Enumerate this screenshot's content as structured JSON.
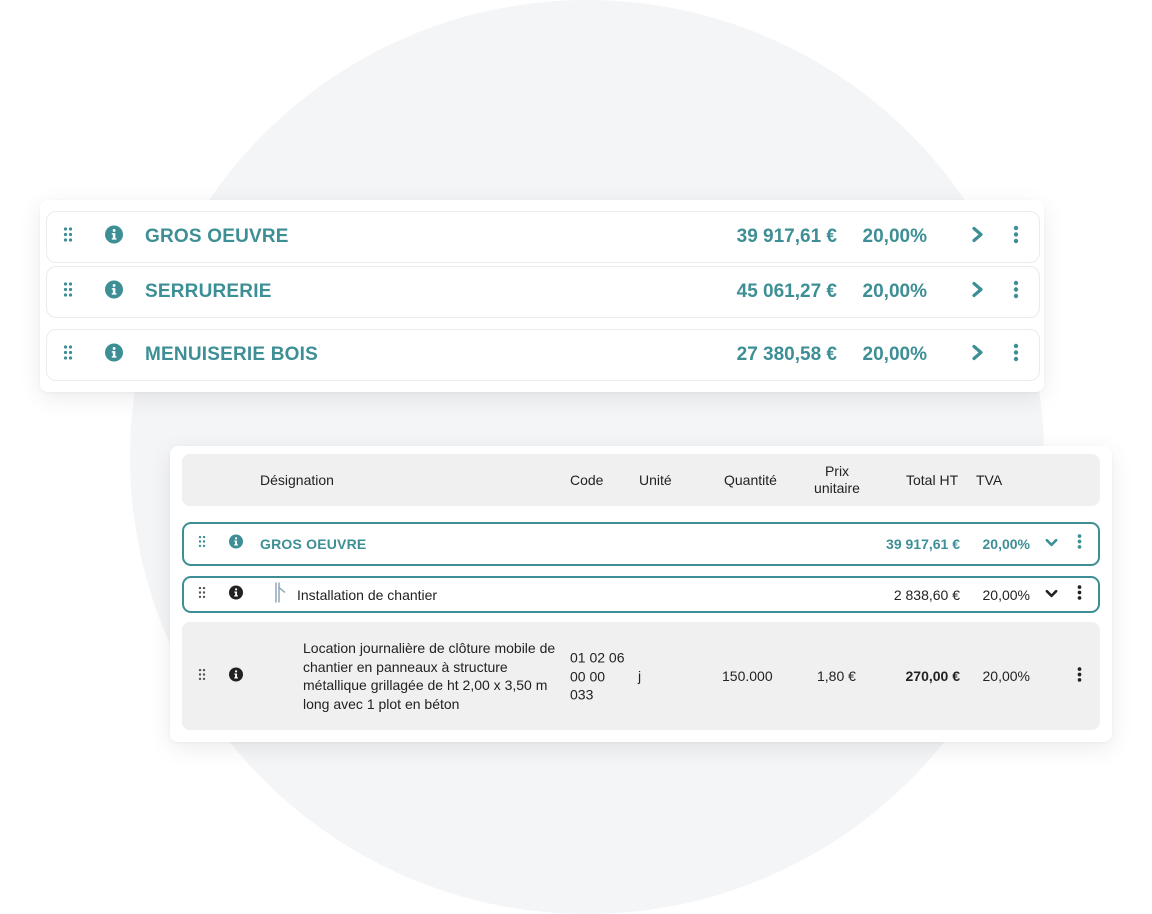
{
  "colors": {
    "accent": "#3d8f95",
    "row_border": "#e9ebee",
    "header_bg": "#f0f0f1",
    "background_circle": "#f4f5f7"
  },
  "lots_summary": [
    {
      "name": "GROS OEUVRE",
      "total": "39 917,61 €",
      "tva": "20,00%"
    },
    {
      "name": "SERRURERIE",
      "total": "45 061,27 €",
      "tva": "20,00%"
    },
    {
      "name": "MENUISERIE BOIS",
      "total": "27 380,58 €",
      "tva": "20,00%"
    }
  ],
  "table": {
    "headers": {
      "designation": "Désignation",
      "code": "Code",
      "unite": "Unité",
      "quantite": "Quantité",
      "prix_unitaire": "Prix unitaire",
      "total_ht": "Total HT",
      "tva": "TVA"
    },
    "lot_row": {
      "label": "GROS OEUVRE",
      "total": "39 917,61 €",
      "tva": "20,00%"
    },
    "sub_row": {
      "label": "Installation de chantier",
      "total": "2 838,60 €",
      "tva": "20,00%"
    },
    "article_row": {
      "designation": "Location journalière de clôture mobile de chantier en panneaux à structure métallique grillagée de ht 2,00 x 3,50 m long avec 1 plot en béton",
      "code": "01 02 06 00 00 033",
      "unite": "j",
      "quantite": "150.000",
      "prix_unitaire": "1,80 €",
      "total_ht": "270,00 €",
      "tva": "20,00%"
    }
  },
  "icons": [
    "drag-handle-icon",
    "info-icon",
    "chevron-right-icon",
    "chevron-down-icon",
    "kebab-menu-icon",
    "tree-branch-icon"
  ]
}
